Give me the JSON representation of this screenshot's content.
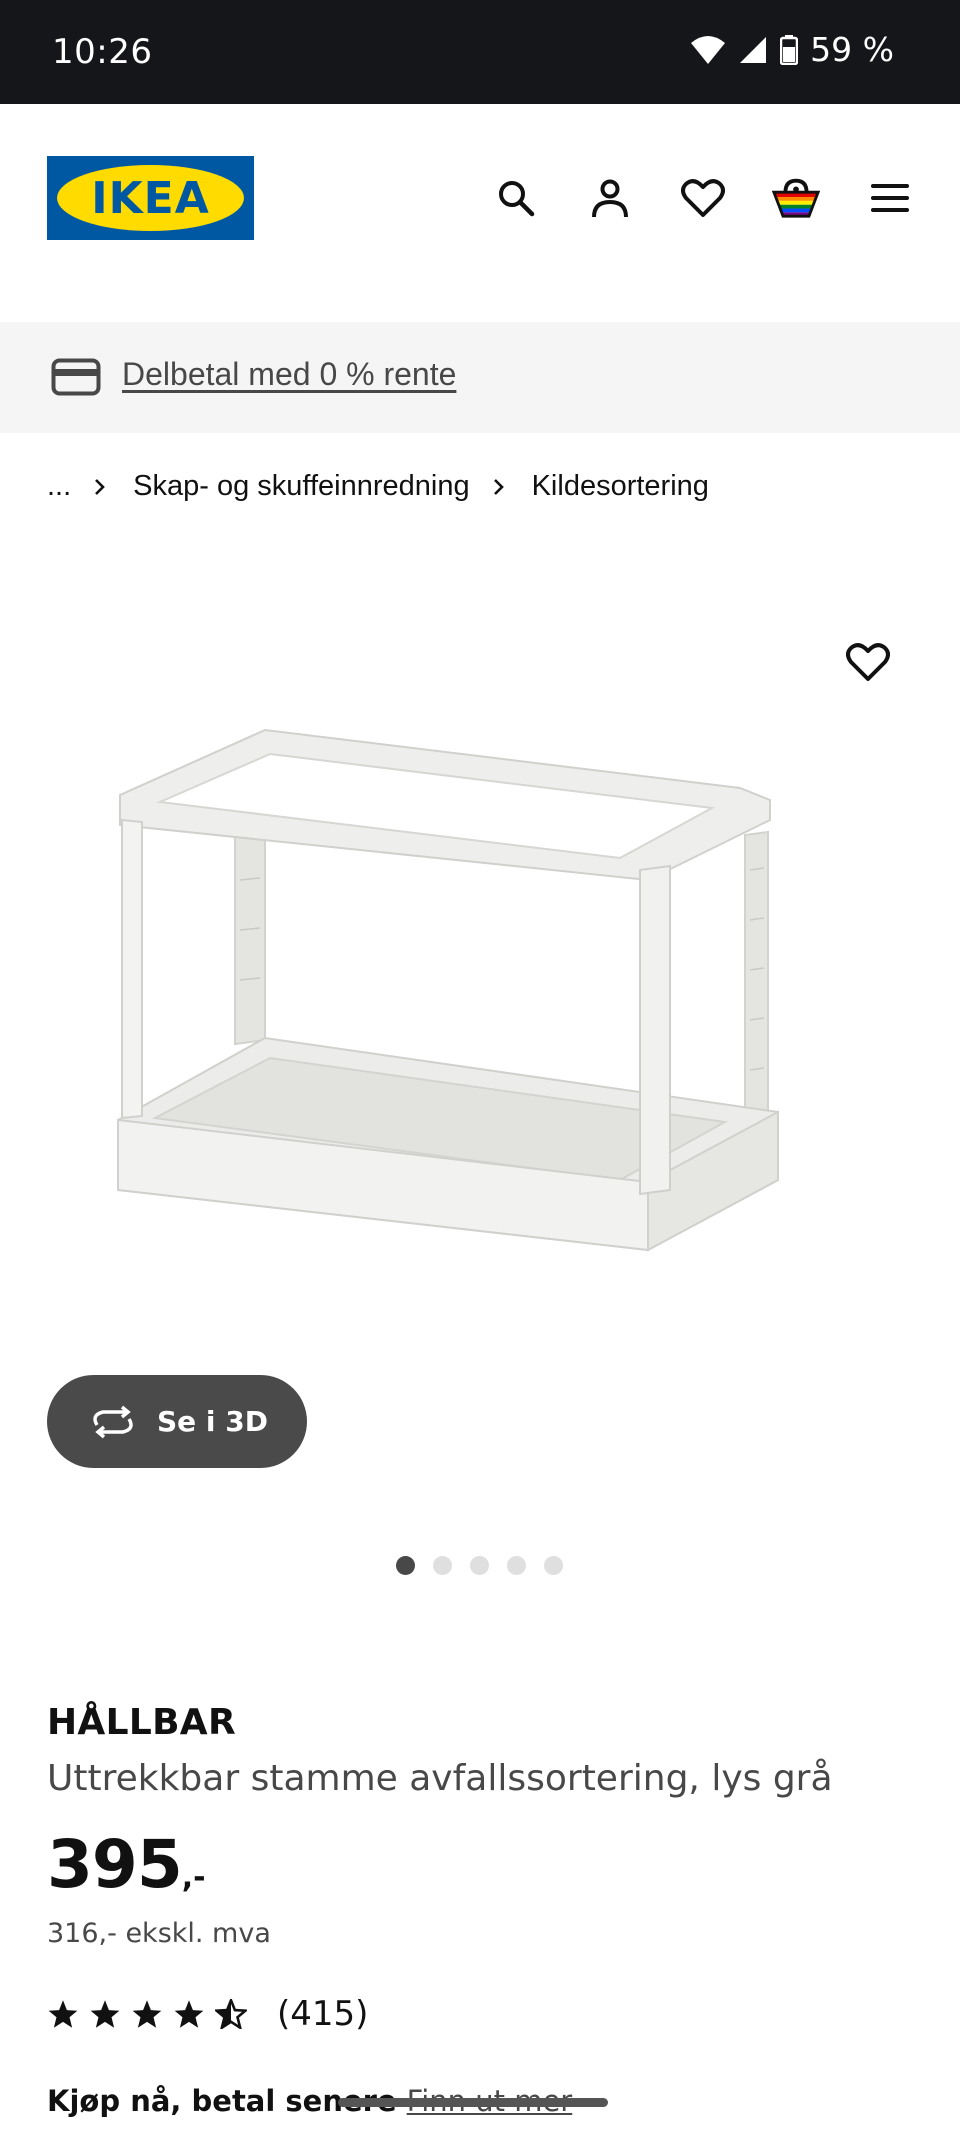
{
  "status_bar": {
    "time": "10:26",
    "battery": "59 %"
  },
  "header": {
    "logo_text": "IKEA",
    "icons": [
      "search-icon",
      "account-icon",
      "heart-icon",
      "basket-icon",
      "menu-icon"
    ]
  },
  "banner": {
    "icon": "credit-card-icon",
    "link_text": "Delbetal med 0 % rente"
  },
  "breadcrumb": {
    "items": [
      "...",
      "Skap- og skuffeinnredning",
      "Kildesortering"
    ]
  },
  "gallery": {
    "view_3d_label": "Se i 3D",
    "image_count": 5,
    "active_index": 0
  },
  "product": {
    "brand": "HÅLLBAR",
    "description": "Uttrekkbar stamme avfallssortering, lys grå",
    "price_main": "395",
    "price_suffix": ",-",
    "price_ex_vat": "316,- ekskl. mva",
    "rating_stars": 4.5,
    "review_count": "(415)",
    "buy_now_label": "Kjøp nå, betal senere",
    "buy_now_link": "Finn ut mer"
  },
  "colors": {
    "ikea_blue": "#0058a3",
    "ikea_yellow": "#ffdb00",
    "text_primary": "#111111",
    "text_secondary": "#484848"
  }
}
